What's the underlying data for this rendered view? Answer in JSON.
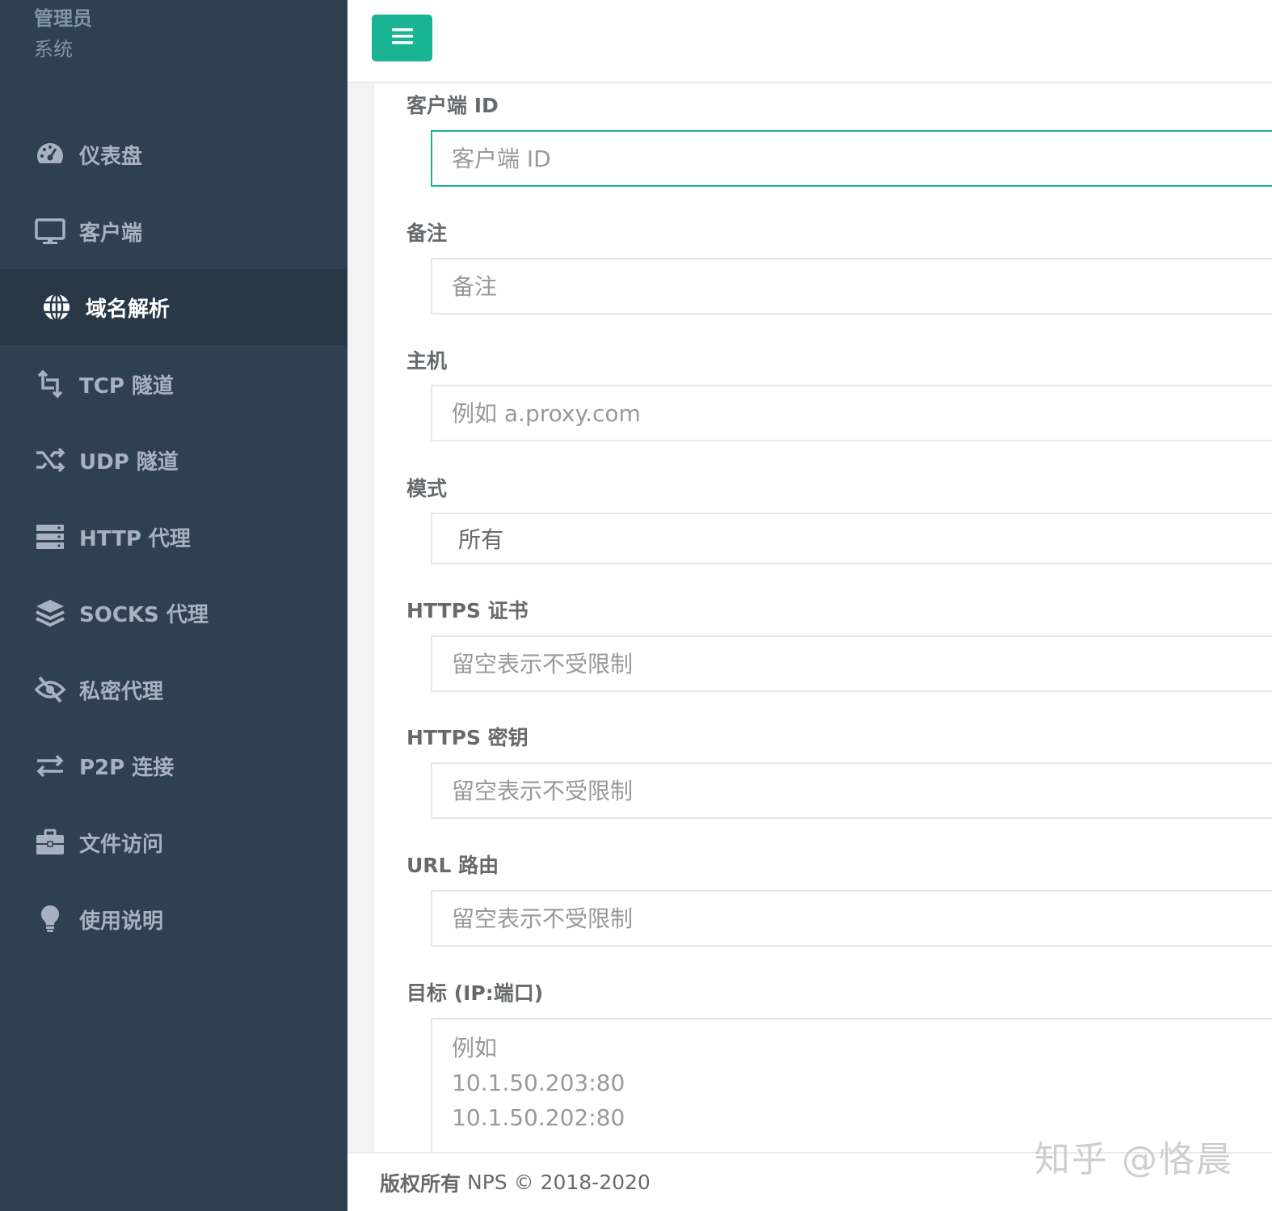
{
  "sidebar": {
    "user_name": "管理员",
    "user_role": "系统",
    "items": [
      {
        "label": "仪表盘",
        "icon": "dashboard-icon"
      },
      {
        "label": "客户端",
        "icon": "monitor-icon"
      },
      {
        "label": "域名解析",
        "icon": "globe-icon",
        "active": true
      },
      {
        "label": "TCP 隧道",
        "icon": "retweet-icon"
      },
      {
        "label": "UDP 隧道",
        "icon": "random-icon"
      },
      {
        "label": "HTTP 代理",
        "icon": "server-icon"
      },
      {
        "label": "SOCKS 代理",
        "icon": "layers-icon"
      },
      {
        "label": "私密代理",
        "icon": "eye-slash-icon"
      },
      {
        "label": "P2P 连接",
        "icon": "exchange-icon"
      },
      {
        "label": "文件访问",
        "icon": "briefcase-icon"
      },
      {
        "label": "使用说明",
        "icon": "lightbulb-icon"
      }
    ]
  },
  "header": {
    "menu_icon": "bars-icon",
    "accent": "#1ab394"
  },
  "form": {
    "client_id": {
      "label": "客户端 ID",
      "placeholder": "客户端 ID"
    },
    "remark": {
      "label": "备注",
      "placeholder": "备注"
    },
    "host": {
      "label": "主机",
      "placeholder": "例如 a.proxy.com"
    },
    "mode": {
      "label": "模式",
      "value": "所有"
    },
    "https_cert": {
      "label": "HTTPS 证书",
      "placeholder": "留空表示不受限制"
    },
    "https_key": {
      "label": "HTTPS 密钥",
      "placeholder": "留空表示不受限制"
    },
    "url_route": {
      "label": "URL 路由",
      "placeholder": "留空表示不受限制"
    },
    "target": {
      "label": "目标 (IP:端口)",
      "placeholder_lines": [
        "例如",
        "10.1.50.203:80",
        "10.1.50.202:80"
      ]
    }
  },
  "footer": {
    "copyright_label": "版权所有",
    "copyright_text": "NPS © 2018-2020"
  },
  "watermark": "知乎 @恪晨",
  "colors": {
    "sidebar_bg": "#2f4050",
    "sidebar_active_bg": "#293846",
    "accent": "#1ab394"
  }
}
